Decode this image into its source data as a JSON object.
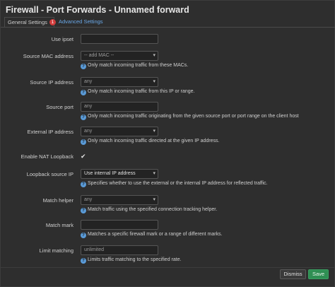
{
  "title": "Firewall - Port Forwards - Unnamed forward",
  "tabs": [
    {
      "label": "General Settings",
      "badge": "1"
    },
    {
      "label": "Advanced Settings"
    }
  ],
  "fields": {
    "use_ipset": {
      "label": "Use ipset",
      "value": ""
    },
    "source_mac": {
      "label": "Source MAC address",
      "value": "-- add MAC --",
      "help": "Only match incoming traffic from these MACs."
    },
    "source_ip": {
      "label": "Source IP address",
      "value": "any",
      "help": "Only match incoming traffic from this IP or range."
    },
    "source_port": {
      "label": "Source port",
      "value": "any",
      "help": "Only match incoming traffic originating from the given source port or port range on the client host"
    },
    "external_ip": {
      "label": "External IP address",
      "value": "any",
      "help": "Only match incoming traffic directed at the given IP address."
    },
    "nat_loopback": {
      "label": "Enable NAT Loopback",
      "checked": true,
      "check_glyph": "✔"
    },
    "loopback_source": {
      "label": "Loopback source IP",
      "value": "Use internal IP address",
      "help": "Specifies whether to use the external or the internal IP address for reflected traffic."
    },
    "match_helper": {
      "label": "Match helper",
      "value": "any",
      "help": "Match traffic using the specified connection tracking helper."
    },
    "match_mark": {
      "label": "Match mark",
      "value": "",
      "help": "Matches a specific firewall mark or a range of different marks."
    },
    "limit_matching": {
      "label": "Limit matching",
      "value": "unlimited",
      "help": "Limits traffic matching to the specified rate."
    }
  },
  "help_glyph": "?",
  "buttons": {
    "dismiss": "Dismiss",
    "save": "Save"
  },
  "colors": {
    "accent": "#6aa8e8",
    "badge": "#d23c3c",
    "save": "#2f8f53",
    "help_icon": "#5a9bd8"
  }
}
